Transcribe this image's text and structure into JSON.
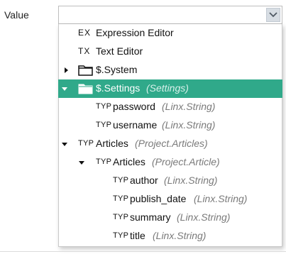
{
  "field": {
    "label": "Value",
    "value": ""
  },
  "icons": {
    "dropdown": "chevron-down-icon",
    "expand": "triangle-right-icon",
    "collapse": "triangle-down-icon",
    "folder": "folder-icon",
    "folder_open": "folder-open-icon"
  },
  "colors": {
    "selected_row": "#30a98a",
    "type_text": "#7a7a7a"
  },
  "tree": [
    {
      "icon_text": "EX",
      "name": "Expression Editor",
      "type": ""
    },
    {
      "icon_text": "TX",
      "name": "Text Editor",
      "type": ""
    },
    {
      "icon_text": "",
      "name": "$.System",
      "type": ""
    },
    {
      "icon_text": "",
      "name": "$.Settings",
      "type": "(Settings)"
    },
    {
      "icon_text": "TYP",
      "name": "password",
      "type": "(Linx.String)"
    },
    {
      "icon_text": "TYP",
      "name": "username",
      "type": "(Linx.String)"
    },
    {
      "icon_text": "TYP",
      "name": "Articles",
      "type": "(Project.Articles)"
    },
    {
      "icon_text": "TYP",
      "name": "Articles",
      "type": "(Project.Article)"
    },
    {
      "icon_text": "TYP",
      "name": "author",
      "type": "(Linx.String)"
    },
    {
      "icon_text": "TYP",
      "name": "publish_date",
      "type": "(Linx.String)"
    },
    {
      "icon_text": "TYP",
      "name": "summary",
      "type": "(Linx.String)"
    },
    {
      "icon_text": "TYP",
      "name": "title",
      "type": "(Linx.String)"
    }
  ]
}
